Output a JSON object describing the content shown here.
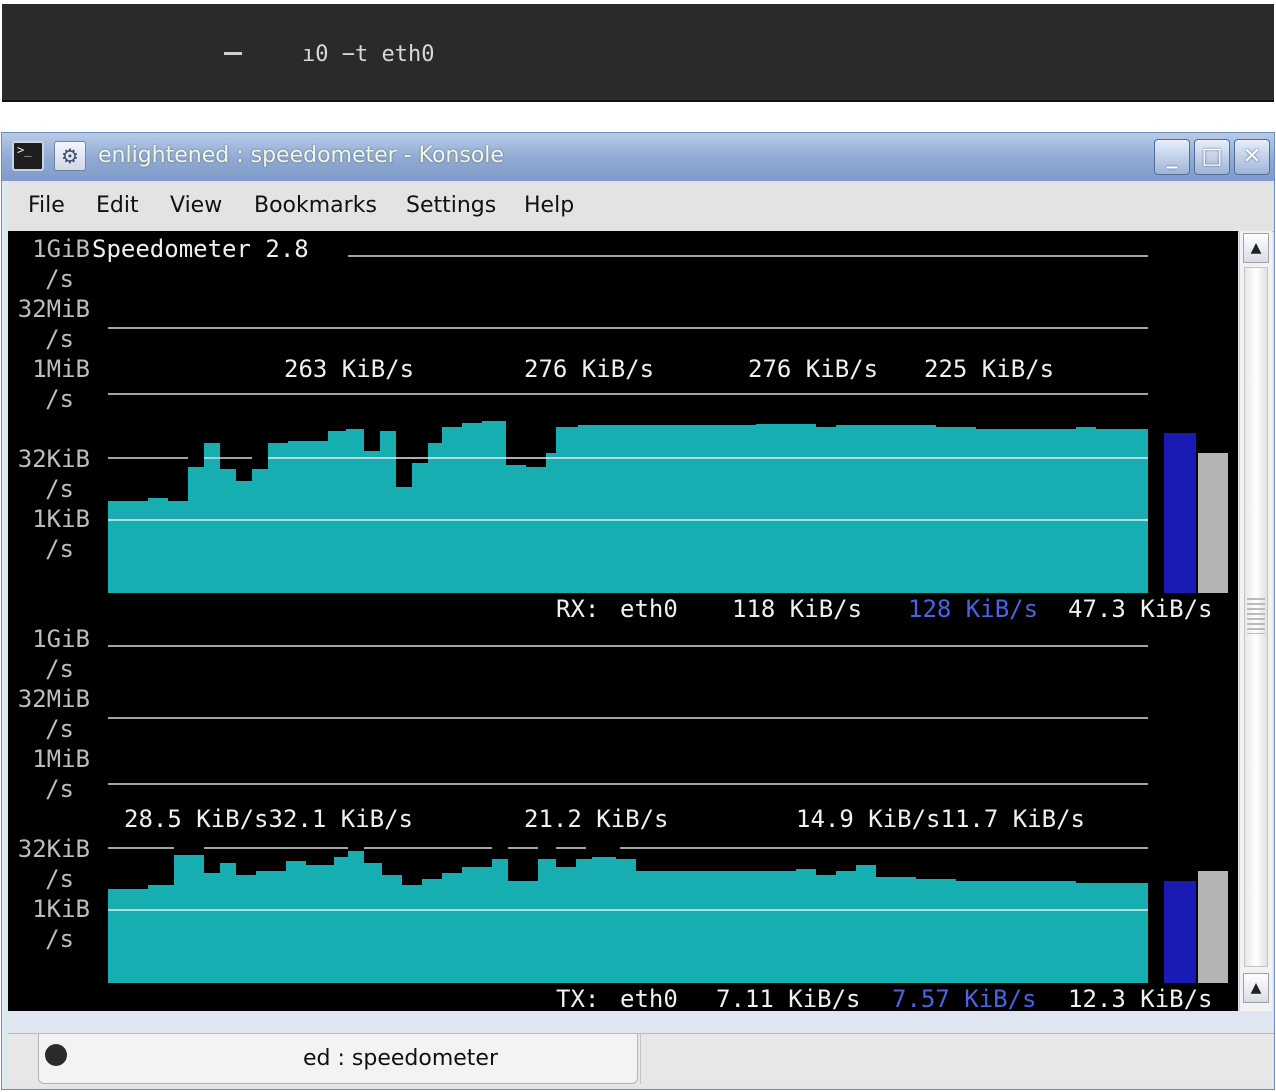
{
  "top_terminal": {
    "command_text": "ı0 −t eth0"
  },
  "window": {
    "title": "enlightened : speedometer - Konsole",
    "controls": {
      "minimize": "_",
      "maximize": "□",
      "close": "✕"
    }
  },
  "menu": [
    "File",
    "Edit",
    "View",
    "Bookmarks",
    "Settings",
    "Help"
  ],
  "terminal": {
    "app_title": "Speedometer 2.8",
    "y_axis_labels": [
      "1GiB",
      "/s",
      "32MiB",
      "/s",
      "1MiB",
      "/s",
      "32KiB",
      "/s",
      "1KiB",
      "/s"
    ],
    "rx": {
      "peak_labels": [
        "263 KiB/s",
        "276 KiB/s",
        "276 KiB/s",
        "225 KiB/s"
      ],
      "status_label": "RX:",
      "interface": "eth0",
      "current": "118 KiB/s",
      "average": "128 KiB/s",
      "min": "47.3 KiB/s"
    },
    "tx": {
      "peak_labels": [
        "28.5 KiB/s32.1 KiB/s",
        "21.2 KiB/s",
        "14.9 KiB/s11.7 KiB/s"
      ],
      "status_label": "TX:",
      "interface": "eth0",
      "current": "7.11 KiB/s",
      "average": "7.57 KiB/s",
      "min": "12.3 KiB/s"
    },
    "colors": {
      "bg": "#000000",
      "fill": "#16aeb0",
      "text": "#e8e8e8",
      "axis_text": "#bdbdbd",
      "average": "#4b63e0",
      "bar_blue": "#1a1ab4",
      "bar_gray": "#b4b4b4",
      "grid": "#d9d9d9"
    }
  },
  "tabbar": {
    "tab_label": "ed : speedometer"
  }
}
